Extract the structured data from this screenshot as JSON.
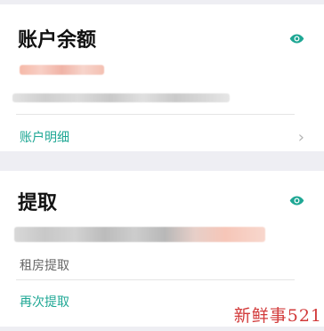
{
  "balance_card": {
    "title": "账户余额",
    "visibility_icon": "eye-icon",
    "details_link": "账户明细",
    "chevron_icon": "chevron-right-icon"
  },
  "withdraw_card": {
    "title": "提取",
    "visibility_icon": "eye-icon",
    "type_label": "租房提取",
    "again_link": "再次提取"
  },
  "watermark": "新鲜事521",
  "colors": {
    "accent": "#1ea794",
    "background": "#eeeef3",
    "watermark": "#d23a3a"
  }
}
